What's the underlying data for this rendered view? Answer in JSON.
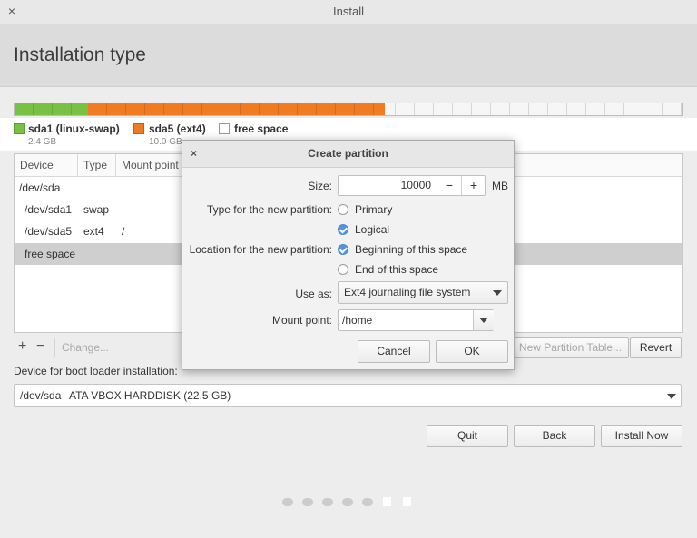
{
  "window": {
    "title": "Install",
    "close_glyph": "×"
  },
  "header": {
    "title": "Installation type"
  },
  "partitions": {
    "legend": [
      {
        "name": "sda1 (linux-swap)",
        "size": "2.4 GB",
        "color": "#79c142"
      },
      {
        "name": "sda5 (ext4)",
        "size": "10.0 GB",
        "color": "#ef7b22"
      },
      {
        "name": "free space",
        "size": "",
        "color": "#ffffff"
      }
    ]
  },
  "table": {
    "columns": [
      "Device",
      "Type",
      "Mount point"
    ],
    "rows": [
      {
        "device": "/dev/sda",
        "type": "",
        "mount": ""
      },
      {
        "device": "/dev/sda1",
        "type": "swap",
        "mount": ""
      },
      {
        "device": "/dev/sda5",
        "type": "ext4",
        "mount": "/"
      },
      {
        "device": "free space",
        "type": "",
        "mount": "",
        "selected": true
      }
    ]
  },
  "toolbar": {
    "add_glyph": "+",
    "remove_glyph": "−",
    "change_label": "Change...",
    "new_table_label": "New Partition Table...",
    "revert_label": "Revert"
  },
  "bootloader": {
    "label": "Device for boot loader installation:",
    "device": "/dev/sda",
    "description": "ATA VBOX HARDDISK (22.5 GB)"
  },
  "buttons": {
    "quit": "Quit",
    "back": "Back",
    "install_now": "Install Now"
  },
  "dialog": {
    "title": "Create partition",
    "close_glyph": "×",
    "size_label": "Size:",
    "size_value": "10000",
    "size_unit": "MB",
    "minus_glyph": "−",
    "plus_glyph": "+",
    "type_label": "Type for the new partition:",
    "type_options": [
      "Primary",
      "Logical"
    ],
    "type_selected": "Logical",
    "location_label": "Location for the new partition:",
    "location_options": [
      "Beginning of this space",
      "End of this space"
    ],
    "location_selected": "Beginning of this space",
    "use_as_label": "Use as:",
    "use_as_value": "Ext4 journaling file system",
    "mount_label": "Mount point:",
    "mount_value": "/home",
    "cancel_label": "Cancel",
    "ok_label": "OK"
  },
  "progress": {
    "total_steps": 7,
    "current_step": 6
  }
}
